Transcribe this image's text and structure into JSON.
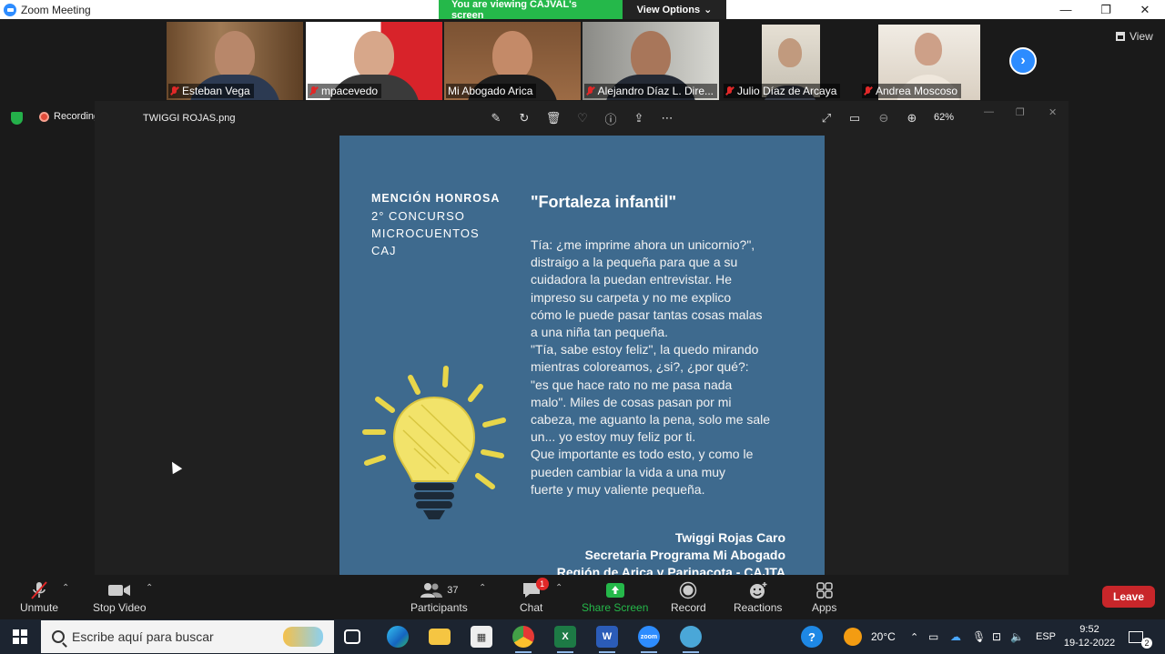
{
  "window": {
    "title": "Zoom Meeting"
  },
  "banner": {
    "viewing": "You are viewing CAJVAL's screen",
    "options": "View Options"
  },
  "gallery": {
    "participants": [
      {
        "name": "Esteban Vega",
        "muted": true
      },
      {
        "name": "mpacevedo",
        "muted": true
      },
      {
        "name": "Mi Abogado Arica",
        "muted": false,
        "active": true
      },
      {
        "name": "Alejandro Díaz L. Dire...",
        "muted": true
      },
      {
        "name": "Julio Díaz de Arcaya",
        "muted": true
      },
      {
        "name": "Andrea Moscoso",
        "muted": true
      }
    ],
    "view_label": "View"
  },
  "viewer": {
    "recording_label": "Recording",
    "file_name": "TWIGGI ROJAS.png",
    "zoom_level": "62%"
  },
  "card": {
    "mention_lines": [
      "MENCIÓN HONROSA",
      "2° CONCURSO",
      "MICROCUENTOS",
      "CAJ"
    ],
    "title": "\"Fortaleza infantil\"",
    "poem_lines": [
      "Tía: ¿me imprime ahora un unicornio?\",",
      "distraigo a la pequeña para que a su",
      "cuidadora la puedan entrevistar. He",
      "impreso su carpeta y no me explico",
      "cómo le puede pasar tantas cosas malas",
      "a una niña tan pequeña.",
      "\"Tía, sabe estoy feliz\", la quedo mirando",
      "mientras coloreamos, ¿si?, ¿por qué?:",
      "\"es que hace rato no me pasa nada",
      "malo\". Miles de cosas pasan por mi",
      "cabeza, me aguanto la pena, solo me sale",
      "un... yo estoy muy feliz por ti.",
      "Que importante es todo esto, y como le",
      "pueden cambiar la vida a una muy",
      "fuerte y muy valiente pequeña."
    ],
    "signature": [
      "Twiggi Rojas Caro",
      "Secretaria Programa Mi Abogado",
      "Región de Arica y Parinacota - CAJTA"
    ]
  },
  "toolbar": {
    "unmute": "Unmute",
    "stop_video": "Stop Video",
    "participants": "Participants",
    "participants_count": "37",
    "chat": "Chat",
    "chat_badge": "1",
    "share_screen": "Share Screen",
    "record": "Record",
    "reactions": "Reactions",
    "apps": "Apps",
    "leave": "Leave"
  },
  "taskbar": {
    "search_placeholder": "Escribe aquí para buscar",
    "temperature": "20°C",
    "language": "ESP",
    "time": "9:52",
    "date": "19-12-2022",
    "notification_count": "2"
  },
  "colors": {
    "card_bg": "#3e6a8e",
    "zoom_blue": "#2d8cff",
    "share_green": "#25b84a",
    "leave_red": "#c8262a"
  }
}
